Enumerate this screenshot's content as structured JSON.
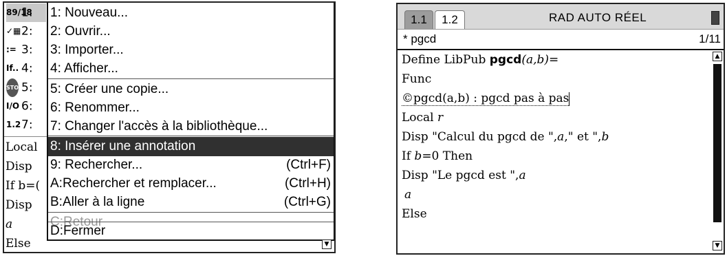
{
  "left": {
    "background_lines": [
      {
        "text": "Local",
        "row": 7
      },
      {
        "text": "Disp",
        "row": 8
      },
      {
        "text": "If b=(",
        "row": 9
      },
      {
        "text": " Disp",
        "row": 10
      },
      {
        "text": " a",
        "row": 11
      },
      {
        "text": "Else",
        "row": 12
      }
    ],
    "icon_items": [
      {
        "icon": "89/18",
        "num": "1:"
      },
      {
        "icon": "✓▦",
        "num": "2:"
      },
      {
        "icon": ":=",
        "num": "3:"
      },
      {
        "icon": "If..",
        "num": "4:"
      },
      {
        "icon": "STOP",
        "num": "5:"
      },
      {
        "icon": "I/O",
        "num": "6:"
      },
      {
        "icon": "1.2",
        "num": "7:"
      }
    ],
    "menu": {
      "items": [
        {
          "label": "1: Nouveau...",
          "shortcut": ""
        },
        {
          "label": "2: Ouvrir...",
          "shortcut": ""
        },
        {
          "label": "3: Importer...",
          "shortcut": ""
        },
        {
          "label": "4: Afficher...",
          "shortcut": ""
        },
        {
          "label": "5: Créer une copie...",
          "shortcut": ""
        },
        {
          "label": "6: Renommer...",
          "shortcut": ""
        },
        {
          "label": "7: Changer l'accès à la bibliothèque...",
          "shortcut": ""
        },
        {
          "label": "8: Insérer une annotation",
          "shortcut": ""
        },
        {
          "label": "9: Rechercher...",
          "shortcut": "(Ctrl+F)"
        },
        {
          "label": "A:Rechercher et remplacer...",
          "shortcut": "(Ctrl+H)"
        },
        {
          "label": "B:Aller à la ligne",
          "shortcut": "(Ctrl+G)"
        },
        {
          "label": "C:Retour",
          "shortcut": ""
        },
        {
          "label": "D:Fermer",
          "shortcut": ""
        }
      ],
      "selected_index": 7,
      "disabled_index": 11
    }
  },
  "right": {
    "tabs": [
      "1.1",
      "1.2"
    ],
    "active_tab": "1.2",
    "mode": "RAD AUTO RÉEL",
    "program_name": "* pgcd",
    "line_indicator": "1/11",
    "code": {
      "line1_prefix": "Define LibPub ",
      "line1_func": "pgcd",
      "line1_args": "(a,b)",
      "line1_suffix": "=",
      "line2": "Func",
      "line3_comment": "©pgcd(a,b) : pgcd pas à pas",
      "line4_kw": "Local ",
      "line4_var": "r",
      "line5_a": "Disp \"Calcul du pgcd de \",",
      "line5_b": "a",
      "line5_c": ",\" et \",",
      "line5_d": "b",
      "line6_a": "If ",
      "line6_b": "b",
      "line6_c": "=0 Then",
      "line7_a": " Disp \"Le pgcd est \",",
      "line7_b": "a",
      "line8": "a",
      "line9": "Else"
    }
  },
  "colors": {
    "highlight": "#303030",
    "tab_inactive": "#9c9c9c",
    "topbar": "#d9d9d9"
  }
}
